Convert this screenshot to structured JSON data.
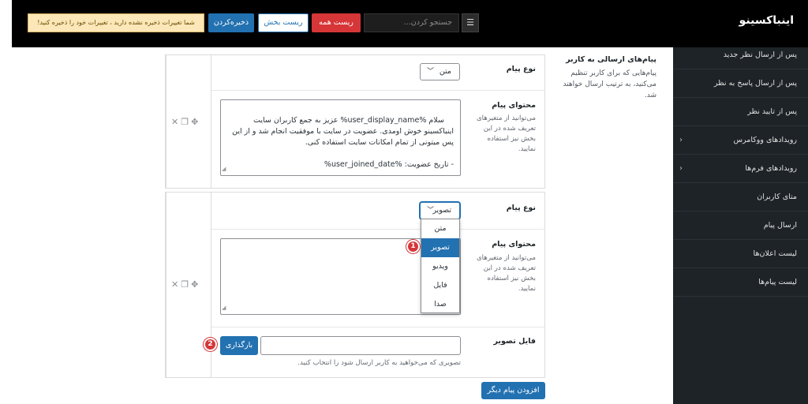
{
  "header": {
    "brand": "اینباکسینو",
    "unsaved_warning": "شما تغییرات ذخیره نشده دارید ، تغییرات خود را ذخیره کنید!",
    "save_label": "ذخیره‌کردن",
    "reset_section_label": "ریست بخش",
    "reset_all_label": "ریست همه",
    "search_placeholder": "جستجو کردن...",
    "search_toggle_icon": "list-toggle-icon"
  },
  "sidebar": {
    "items": [
      {
        "label": "پس از ارسال نظر جدید"
      },
      {
        "label": "پس از ارسال پاسخ به نظر"
      },
      {
        "label": "پس از تایید نظر"
      },
      {
        "label": "رویدادهای ووکامرس",
        "has_children": true
      },
      {
        "label": "رویدادهای فرم‌ها",
        "has_children": true
      },
      {
        "label": "متای کاربران"
      },
      {
        "label": "ارسال پیام"
      },
      {
        "label": "لیست اعلان‌ها"
      },
      {
        "label": "لیست پیام‌ها"
      }
    ]
  },
  "section": {
    "title": "پیام‌های ارسالی به کاربر",
    "description": "پیام‌هایی که برای کاربر تنظیم می‌کنید، به ترتیب ارسال خواهند شد."
  },
  "messages": [
    {
      "type_label": "نوع پیام",
      "type_value": "متن",
      "content_label": "محتوای پیام",
      "content_help": "می‌توانید از متغیرهای تعریف شده در این بخش نیز استفاده نمایید.",
      "content_value": "سلام %user_display_name% عزیز به جمع کاربران سایت اینباکسینو خوش اومدی. عضویت در سایت با موفقیت انجام شد و از این پس میتونی از تمام امکانات سایت استفاده کنی.\n\n- تاریخ عضویت: %user_joined_date%"
    },
    {
      "type_label": "نوع پیام",
      "type_value": "تصویر",
      "type_options": [
        "متن",
        "تصویر",
        "ویدیو",
        "فایل",
        "صدا"
      ],
      "selected_option_index": 1,
      "content_label": "محتوای پیام",
      "content_help": "می‌توانید از متغیرهای تعریف شده در این بخش نیز استفاده نمایید.",
      "content_value": "",
      "file_label": "فایل تصویر",
      "file_value": "",
      "upload_label": "بارگذاری",
      "file_help": "تصویری که می‌خواهید به کاربر ارسال شود را انتخاب کنید."
    }
  ],
  "add_message_label": "افزودن پیام دیگر",
  "row_tools": {
    "icons": [
      "close-icon",
      "duplicate-icon",
      "move-icon"
    ],
    "glyphs": "✕ ❐ ✥"
  },
  "annotations": [
    {
      "number": "1"
    },
    {
      "number": "2"
    }
  ],
  "colors": {
    "primary": "#2271b1",
    "danger": "#d63638",
    "warning_bg": "#fbe7b8",
    "sidebar_bg": "#1d2327",
    "header_bg": "#000000"
  }
}
